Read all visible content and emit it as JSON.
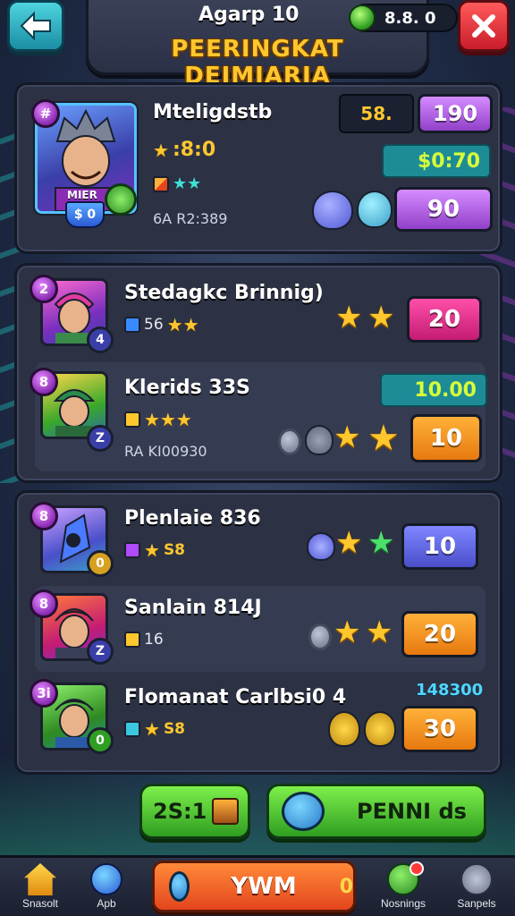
{
  "header": {
    "level_text": "Agarp 10",
    "currency": "8.8. 0",
    "subtitle": "PEERINGKAT DEIMIARIA"
  },
  "featured": {
    "rank": "#",
    "avatar_tag": "MIER",
    "avatar_badge": "$ 0",
    "name": "Mteligdstb",
    "stars_text": ":8:0",
    "meta_tag": "6A R2:389",
    "top_value": "58.",
    "top_score": "190",
    "teal_value": "$0:70",
    "score": "90"
  },
  "group1": [
    {
      "rank": "2",
      "name": "Stedagkc Brinnig)",
      "meta": "56",
      "level": "4",
      "score": "20",
      "score_style": "magenta"
    },
    {
      "rank": "8",
      "name": "Klerids 33S",
      "meta": "",
      "tag": "RA KI00930",
      "teal_value": "10.00",
      "level": "Z",
      "score": "10",
      "score_style": "orange"
    }
  ],
  "group2": [
    {
      "rank": "8",
      "name": "Plenlaie 836",
      "meta": "S8",
      "level": "0",
      "score": "10",
      "score_style": "indigo"
    },
    {
      "rank": "8",
      "name": "Sanlain 814J",
      "meta": "16",
      "level": "Z",
      "score": "20",
      "score_style": "orange"
    },
    {
      "rank": "3i",
      "name": "Flomanat Carlbsi0 4",
      "meta": "S8",
      "level": "0",
      "score": "30",
      "score_style": "orange",
      "cyan_value": "148300"
    }
  ],
  "actions": {
    "left_label": "2S:1",
    "right_label": "PENNI ds"
  },
  "nav": {
    "items": [
      {
        "label": "Snasolt",
        "icon": "home-icon"
      },
      {
        "label": "Apb",
        "icon": "compass-icon"
      },
      {
        "label": "Nosnings",
        "icon": "notification-icon"
      },
      {
        "label": "Sanpels",
        "icon": "menu-icon"
      }
    ],
    "play_label": "YWM",
    "play_count": "0"
  },
  "colors": {
    "accent_gold": "#ffc72e",
    "panel": "#2c3244",
    "teal": "#1e8c96"
  }
}
